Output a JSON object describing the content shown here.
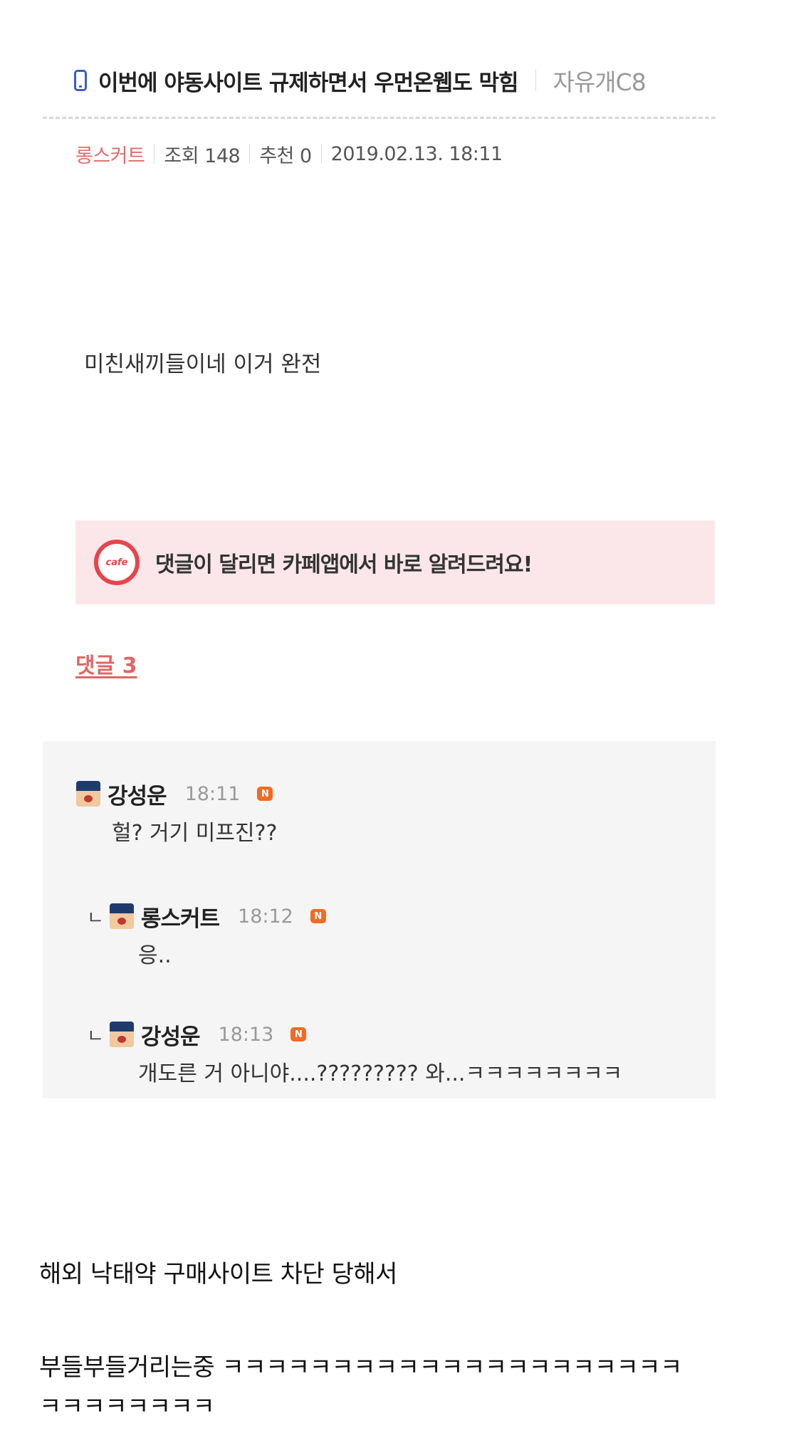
{
  "post": {
    "title": "이번에 야동사이트 규제하면서 우먼온웹도 막힘",
    "board": "자유개C8",
    "author": "롱스커트",
    "views": "조회 148",
    "likes": "추천 0",
    "datetime": "2019.02.13. 18:11",
    "body": "미친새끼들이네 이거 완전"
  },
  "notice": {
    "icon_label": "cafe",
    "text": "댓글이 달리면 카페앱에서 바로 알려드려요!"
  },
  "comments_section": {
    "heading": "댓글 3",
    "items": [
      {
        "reply": "",
        "name": "강성운",
        "time": "18:11",
        "badge": "N",
        "text": "헐? 거기 미프진??"
      },
      {
        "reply": "ㄴ",
        "name": "롱스커트",
        "time": "18:12",
        "badge": "N",
        "text": "응.."
      },
      {
        "reply": "ㄴ",
        "name": "강성운",
        "time": "18:13",
        "badge": "N",
        "text": "개도른 거 아니야....????????? 와...ㅋㅋㅋㅋㅋㅋㅋㅋ"
      }
    ]
  },
  "caption": {
    "line1": "해외 낙태약 구매사이트 차단 당해서",
    "line2": "부들부들거리는중 ㅋㅋㅋㅋㅋㅋㅋㅋㅋㅋㅋㅋㅋㅋㅋㅋㅋㅋㅋㅋㅋ",
    "line3": "ㅋㅋㅋㅋㅋㅋㅋㅋ"
  },
  "colors": {
    "accent_red": "#e06666",
    "notice_bg": "#fbe7e9",
    "comment_bg": "#f5f5f5",
    "badge_orange": "#f26a24",
    "phone_icon_blue": "#3b5ccc"
  }
}
